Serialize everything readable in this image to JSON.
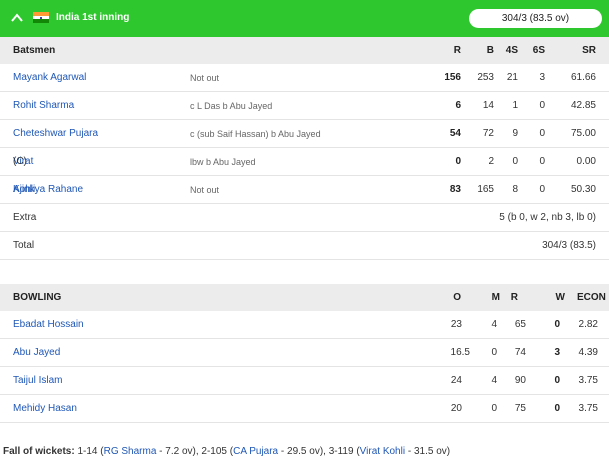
{
  "header": {
    "team": "India 1st inning",
    "score": "304/3 (83.5 ov)"
  },
  "batting": {
    "headers": {
      "name": "Batsmen",
      "r": "R",
      "b": "B",
      "fours": "4S",
      "sixes": "6S",
      "sr": "SR"
    },
    "rows": [
      {
        "name": "Mayank Agarwal",
        "tag": "",
        "dismissal": "Not out",
        "r": "156",
        "b": "253",
        "fours": "21",
        "sixes": "3",
        "sr": "61.66"
      },
      {
        "name": "Rohit Sharma",
        "tag": "",
        "dismissal": "c L Das b Abu Jayed",
        "r": "6",
        "b": "14",
        "fours": "1",
        "sixes": "0",
        "sr": "42.85"
      },
      {
        "name": "Cheteshwar Pujara",
        "tag": "",
        "dismissal": "c (sub Saif Hassan) b Abu Jayed",
        "r": "54",
        "b": "72",
        "fours": "9",
        "sixes": "0",
        "sr": "75.00"
      },
      {
        "name": "Virat Kohli",
        "tag": "(C)",
        "dismissal": "lbw b Abu Jayed",
        "r": "0",
        "b": "2",
        "fours": "0",
        "sixes": "0",
        "sr": "0.00"
      },
      {
        "name": "Ajinkya Rahane",
        "tag": "",
        "dismissal": "Not out",
        "r": "83",
        "b": "165",
        "fours": "8",
        "sixes": "0",
        "sr": "50.30"
      }
    ],
    "extra": {
      "label": "Extra",
      "value": "5 (b 0, w 2, nb 3, lb 0)"
    },
    "total": {
      "label": "Total",
      "value": "304/3 (83.5)"
    }
  },
  "bowling": {
    "headers": {
      "name": "BOWLING",
      "o": "O",
      "m": "M",
      "r": "R",
      "w": "W",
      "econ": "ECON"
    },
    "rows": [
      {
        "name": "Ebadat Hossain",
        "o": "23",
        "m": "4",
        "r": "65",
        "w": "0",
        "econ": "2.82"
      },
      {
        "name": "Abu Jayed",
        "o": "16.5",
        "m": "0",
        "r": "74",
        "w": "3",
        "econ": "4.39"
      },
      {
        "name": "Taijul Islam",
        "o": "24",
        "m": "4",
        "r": "90",
        "w": "0",
        "econ": "3.75"
      },
      {
        "name": "Mehidy Hasan",
        "o": "20",
        "m": "0",
        "r": "75",
        "w": "0",
        "econ": "3.75"
      }
    ]
  },
  "fall_of_wickets": {
    "label": "Fall of wickets:",
    "items": [
      {
        "pre": " 1-14 (",
        "player": "RG Sharma",
        "post": " - 7.2 ov), "
      },
      {
        "pre": "2-105 (",
        "player": "CA Pujara",
        "post": " - 29.5 ov), "
      },
      {
        "pre": "3-119 (",
        "player": "Virat Kohli",
        "post": " - 31.5 ov)"
      }
    ]
  },
  "colors": {
    "header_green": "#2ec82e",
    "link_blue": "#1f57b6",
    "section_gray": "#ececec"
  },
  "icons": {
    "collapse": "chevron-up-icon",
    "team_flag": "india-flag-icon"
  }
}
